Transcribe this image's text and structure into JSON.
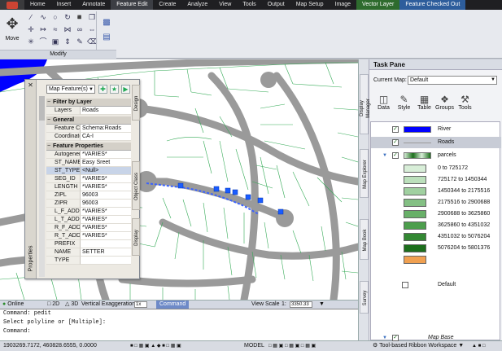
{
  "ribbon_tabs": [
    "Home",
    "Insert",
    "Annotate",
    "Feature Edit",
    "Create",
    "Analyze",
    "View",
    "Tools",
    "Output",
    "Map Setup",
    "Image",
    "Vector Layer",
    "Feature Checked Out"
  ],
  "ribbon": {
    "move_label": "Move",
    "panel_label": "Modify"
  },
  "properties": {
    "title": "Properties",
    "selector": "Map Feature(s)",
    "sections": {
      "filter": "Filter by Layer",
      "general": "General",
      "feature": "Feature Properties"
    },
    "filter_rows": [
      {
        "k": "Layers",
        "v": "Roads"
      }
    ],
    "general_rows": [
      {
        "k": "Feature Class",
        "v": "Schema:Roads"
      },
      {
        "k": "Coordinate...",
        "v": "CA-I"
      }
    ],
    "feature_rows": [
      {
        "k": "Autogener...",
        "v": "*VARIES*"
      },
      {
        "k": "ST_NAME",
        "v": "Easy Sreet"
      },
      {
        "k": "ST_TYPE",
        "v": "<Null>"
      },
      {
        "k": "SEG_ID",
        "v": "*VARIES*"
      },
      {
        "k": "LENGTH",
        "v": "*VARIES*"
      },
      {
        "k": "ZIPL",
        "v": "96003"
      },
      {
        "k": "ZIPR",
        "v": "96003"
      },
      {
        "k": "L_F_ADD",
        "v": "*VARIES*"
      },
      {
        "k": "L_T_ADD",
        "v": "*VARIES*"
      },
      {
        "k": "R_F_ADD",
        "v": "*VARIES*"
      },
      {
        "k": "R_T_ADD",
        "v": "*VARIES*"
      },
      {
        "k": "PREFIX",
        "v": ""
      },
      {
        "k": "NAME",
        "v": "SETTER"
      },
      {
        "k": "TYPE",
        "v": ""
      }
    ],
    "side_tabs": [
      "Design",
      "Object Class",
      "Display"
    ]
  },
  "statusbar": {
    "online": "Online",
    "two_d": "2D",
    "three_d": "3D",
    "vert_exag": "Vertical Exaggeration",
    "vert_value": "1x",
    "command": "Command",
    "view_scale_label": "View Scale",
    "view_scale_value": "1:",
    "scale_value": "3350.33"
  },
  "command_line": [
    "Command: pedit",
    "Select polyline or [Multiple]:",
    "Command:"
  ],
  "bottom_bar": {
    "coords": "1903269.7172, 460828.6555, 0.0000",
    "model": "MODEL",
    "workspace": "Tool-based Ribbon Workspace"
  },
  "task_pane": {
    "title": "Task Pane",
    "current_map_label": "Current Map:",
    "current_map_value": "Default",
    "tools": [
      "Data",
      "Style",
      "Table",
      "Groups",
      "Tools"
    ],
    "side_tabs": [
      "Display Manager",
      "Map Explorer",
      "Map Book",
      "Survey"
    ],
    "layers": [
      {
        "name": "River",
        "color": "#0000ff"
      },
      {
        "name": "Roads",
        "color": "#9a9a9a"
      },
      {
        "name": "parcels"
      }
    ],
    "legend": [
      {
        "label": "0 to 725172",
        "color": "#d8eed8"
      },
      {
        "label": "725172 to 1450344",
        "color": "#bce0bc"
      },
      {
        "label": "1450344 to 2175516",
        "color": "#a0d0a0"
      },
      {
        "label": "2175516 to 2900688",
        "color": "#84c084"
      },
      {
        "label": "2900688 to 3625860",
        "color": "#68b068"
      },
      {
        "label": "3625860 to 4351032",
        "color": "#4c9e4c"
      },
      {
        "label": "4351032 to 5076204",
        "color": "#338833"
      },
      {
        "label": "5076204 to 5801376",
        "color": "#1c6e1c"
      },
      {
        "label": "",
        "color": "#f0a050"
      }
    ],
    "map_base": "Map Base",
    "default": "Default"
  }
}
